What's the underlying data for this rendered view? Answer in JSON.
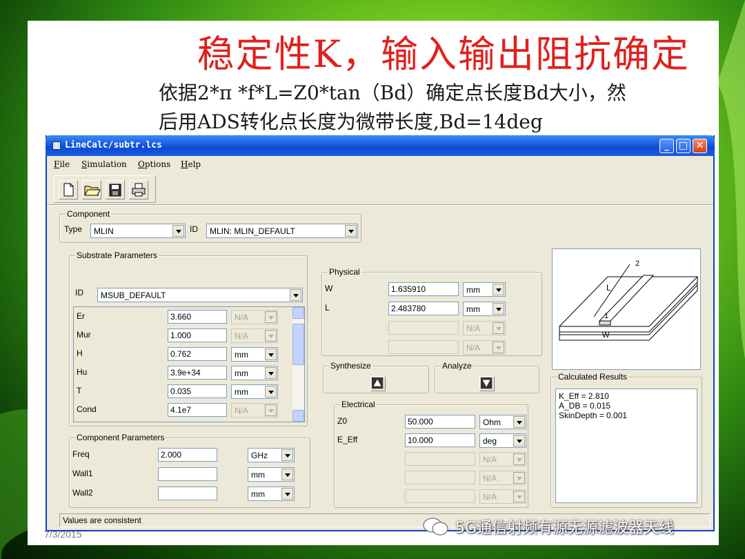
{
  "slide": {
    "title": "稳定性K，输入输出阻抗确定",
    "subtitle_line1": "依据2*π *f*L=Z0*tan（Bd）确定点长度Bd大小，然",
    "subtitle_line2": "后用ADS转化点长度为微带长度,Bd=14deg",
    "footer_date": "7/3/2015",
    "watermark": "5G通信射频有源无源滤波器天线"
  },
  "window": {
    "title": "LineCalc/subtr.lcs",
    "menu": [
      "File",
      "Simulation",
      "Options",
      "Help"
    ],
    "toolbar_icons": [
      "new-icon",
      "open-icon",
      "save-icon",
      "print-icon"
    ],
    "status": "Values are consistent"
  },
  "component": {
    "label": "Component",
    "type_label": "Type",
    "type_value": "MLIN",
    "id_label": "ID",
    "id_value": "MLIN: MLIN_DEFAULT"
  },
  "substrate": {
    "label": "Substrate Parameters",
    "id_label": "ID",
    "id_value": "MSUB_DEFAULT",
    "rows": [
      {
        "name": "Er",
        "value": "3.660",
        "unit": "N/A",
        "unit_enabled": false
      },
      {
        "name": "Mur",
        "value": "1.000",
        "unit": "N/A",
        "unit_enabled": false
      },
      {
        "name": "H",
        "value": "0.762",
        "unit": "mm",
        "unit_enabled": true
      },
      {
        "name": "Hu",
        "value": "3.9e+34",
        "unit": "mm",
        "unit_enabled": true
      },
      {
        "name": "T",
        "value": "0.035",
        "unit": "mm",
        "unit_enabled": true
      },
      {
        "name": "Cond",
        "value": "4.1e7",
        "unit": "N/A",
        "unit_enabled": false
      }
    ]
  },
  "component_params": {
    "label": "Component Parameters",
    "rows": [
      {
        "name": "Freq",
        "value": "2.000",
        "unit": "GHz"
      },
      {
        "name": "Wall1",
        "value": "",
        "unit": "mm"
      },
      {
        "name": "Wall2",
        "value": "",
        "unit": "mm"
      }
    ]
  },
  "physical": {
    "label": "Physical",
    "rows": [
      {
        "name": "W",
        "value": "1.635910",
        "unit": "mm",
        "enabled": true
      },
      {
        "name": "L",
        "value": "2.483780",
        "unit": "mm",
        "enabled": true
      },
      {
        "name": "",
        "value": "",
        "unit": "N/A",
        "enabled": false
      },
      {
        "name": "",
        "value": "",
        "unit": "N/A",
        "enabled": false
      }
    ]
  },
  "synthesize": {
    "label": "Synthesize"
  },
  "analyze": {
    "label": "Analyze"
  },
  "electrical": {
    "label": "Electrical",
    "rows": [
      {
        "name": "Z0",
        "value": "50.000",
        "unit": "Ohm",
        "enabled": true
      },
      {
        "name": "E_Eff",
        "value": "10.000",
        "unit": "deg",
        "enabled": true
      },
      {
        "name": "",
        "value": "",
        "unit": "N/A",
        "enabled": false
      },
      {
        "name": "",
        "value": "",
        "unit": "N/A",
        "enabled": false
      },
      {
        "name": "",
        "value": "",
        "unit": "N/A",
        "enabled": false
      }
    ]
  },
  "diagram": {
    "port1": "1",
    "port2": "2",
    "length_label": "L",
    "width_label": "W"
  },
  "results": {
    "label": "Calculated Results",
    "lines": [
      "K_Eff = 2.810",
      "A_DB = 0.015",
      "SkinDepth = 0.001"
    ]
  }
}
